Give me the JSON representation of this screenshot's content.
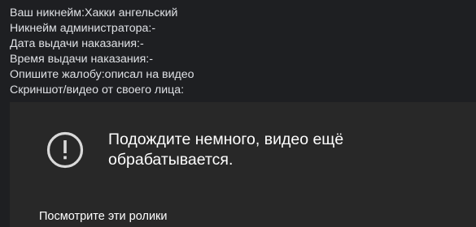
{
  "post": {
    "lines": [
      "Ваш никнейм:Хакки ангельский",
      "Никнейм администратора:-",
      "Дата выдачи наказания:-",
      "Время выдачи наказания:-",
      "Опишите жалобу:описал на видео",
      "Скриншот/видео от своего лица:"
    ]
  },
  "video": {
    "status_icon": "alert-circle-icon",
    "message_lines": [
      "Подождите немного, видео ещё",
      "обрабатывается."
    ],
    "suggestions_heading": "Посмотрите эти ролики"
  },
  "colors": {
    "page_background": "#1e1f22",
    "post_text": "#dfe1e5",
    "video_background": "#282828",
    "video_text": "#ffffff",
    "icon": "#d9d9d9"
  }
}
